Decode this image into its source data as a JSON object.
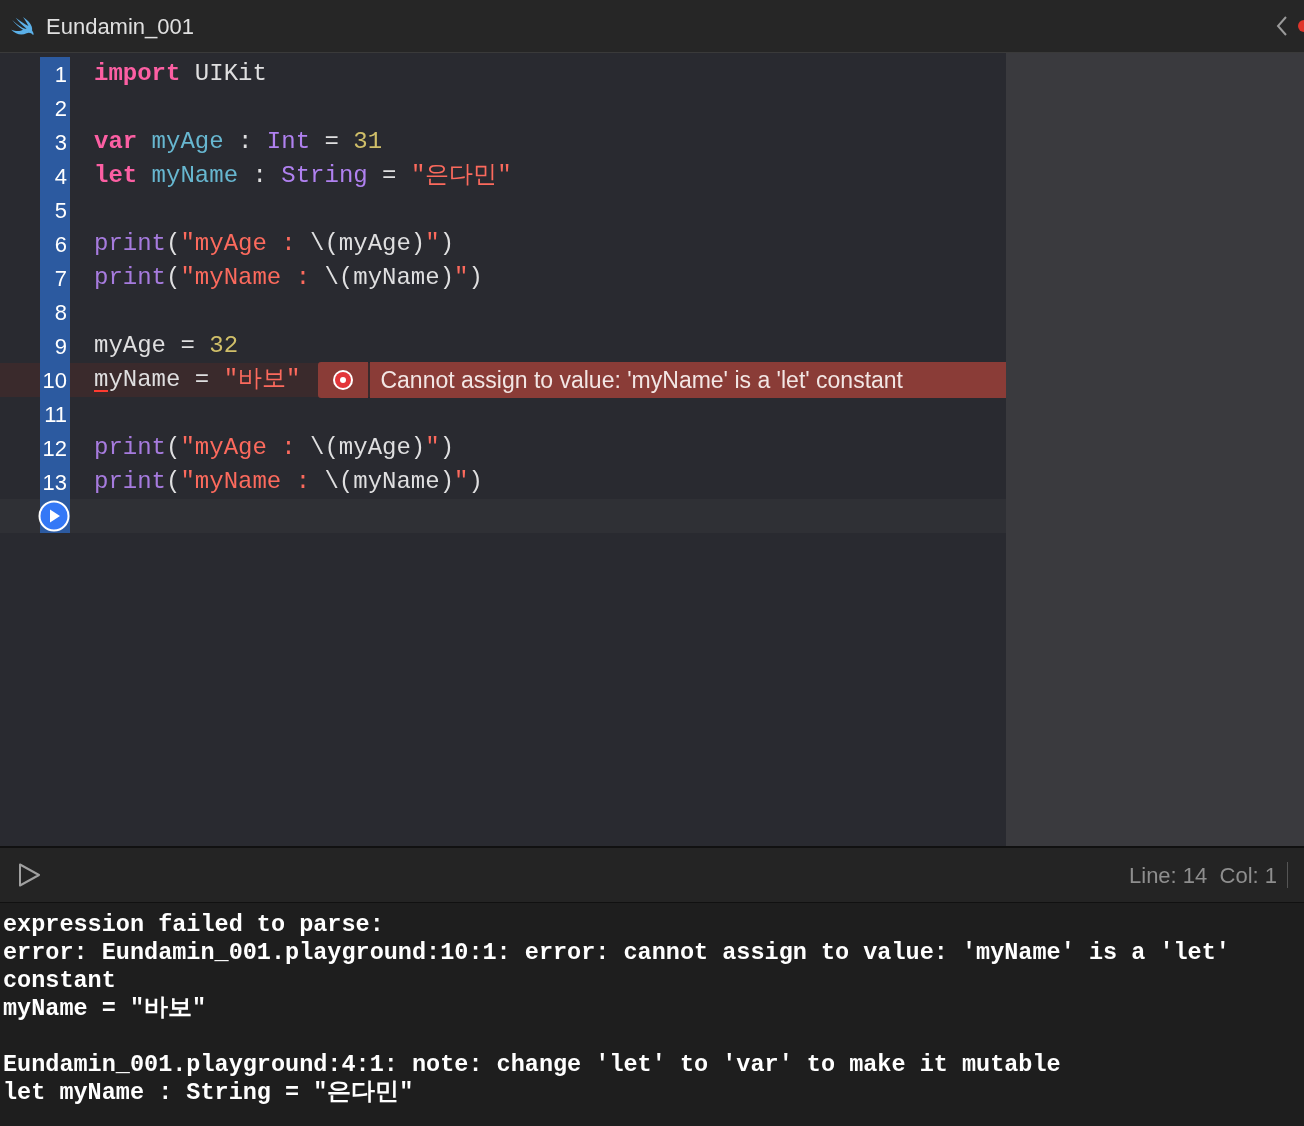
{
  "window": {
    "title": "Eundamin_001"
  },
  "editor": {
    "lines": [
      {
        "number": "1",
        "tokens": [
          {
            "text": "import",
            "kind": "keyword"
          },
          {
            "text": " UIKit",
            "kind": "plain"
          }
        ]
      },
      {
        "number": "2"
      },
      {
        "number": "3",
        "tokens": [
          {
            "text": "var",
            "kind": "keyword"
          },
          {
            "text": " myAge",
            "kind": "ident"
          },
          {
            "text": " : ",
            "kind": "plain"
          },
          {
            "text": "Int",
            "kind": "type"
          },
          {
            "text": " = ",
            "kind": "plain"
          },
          {
            "text": "31",
            "kind": "number"
          }
        ]
      },
      {
        "number": "4",
        "tokens": [
          {
            "text": "let",
            "kind": "keyword"
          },
          {
            "text": " myName",
            "kind": "ident"
          },
          {
            "text": " : ",
            "kind": "plain"
          },
          {
            "text": "String",
            "kind": "type"
          },
          {
            "text": " = ",
            "kind": "plain"
          },
          {
            "text": "\"은다민\"",
            "kind": "string"
          }
        ]
      },
      {
        "number": "5"
      },
      {
        "number": "6",
        "tokens": [
          {
            "text": "print",
            "kind": "func"
          },
          {
            "text": "(",
            "kind": "plain"
          },
          {
            "text": "\"myAge : ",
            "kind": "string"
          },
          {
            "text": "\\(myAge)",
            "kind": "plain"
          },
          {
            "text": "\"",
            "kind": "string"
          },
          {
            "text": ")",
            "kind": "plain"
          }
        ]
      },
      {
        "number": "7",
        "tokens": [
          {
            "text": "print",
            "kind": "func"
          },
          {
            "text": "(",
            "kind": "plain"
          },
          {
            "text": "\"myName : ",
            "kind": "string"
          },
          {
            "text": "\\(myName)",
            "kind": "plain"
          },
          {
            "text": "\"",
            "kind": "string"
          },
          {
            "text": ")",
            "kind": "plain"
          }
        ]
      },
      {
        "number": "8"
      },
      {
        "number": "9",
        "tokens": [
          {
            "text": "myAge",
            "kind": "plain"
          },
          {
            "text": " = ",
            "kind": "plain"
          },
          {
            "text": "32",
            "kind": "number"
          }
        ]
      },
      {
        "number": "10",
        "error": "Cannot assign to value: 'myName' is a 'let' constant",
        "tokens": [
          {
            "text": "m",
            "kind": "plain",
            "underlined": true
          },
          {
            "text": "yName",
            "kind": "plain"
          },
          {
            "text": " = ",
            "kind": "plain"
          },
          {
            "text": "\"바보\"",
            "kind": "string"
          }
        ]
      },
      {
        "number": "11"
      },
      {
        "number": "12",
        "tokens": [
          {
            "text": "print",
            "kind": "func"
          },
          {
            "text": "(",
            "kind": "plain"
          },
          {
            "text": "\"myAge : ",
            "kind": "string"
          },
          {
            "text": "\\(myAge)",
            "kind": "plain"
          },
          {
            "text": "\"",
            "kind": "string"
          },
          {
            "text": ")",
            "kind": "plain"
          }
        ]
      },
      {
        "number": "13",
        "tokens": [
          {
            "text": "print",
            "kind": "func"
          },
          {
            "text": "(",
            "kind": "plain"
          },
          {
            "text": "\"myName : ",
            "kind": "string"
          },
          {
            "text": "\\(myName)",
            "kind": "plain"
          },
          {
            "text": "\"",
            "kind": "string"
          },
          {
            "text": ")",
            "kind": "plain"
          }
        ]
      },
      {
        "current": true
      }
    ]
  },
  "status_bar": {
    "position": "Line: 14  Col: 1"
  },
  "console": {
    "messages": [
      [
        "expression failed to parse:",
        "error: Eundamin_001.playground:10:1: error: cannot assign to value: 'myName' is a 'let' constant",
        "myName = \"바보\""
      ],
      [
        "Eundamin_001.playground:4:1: note: change 'let' to 'var' to make it mutable",
        "let myName : String = \"은다민\""
      ]
    ]
  }
}
